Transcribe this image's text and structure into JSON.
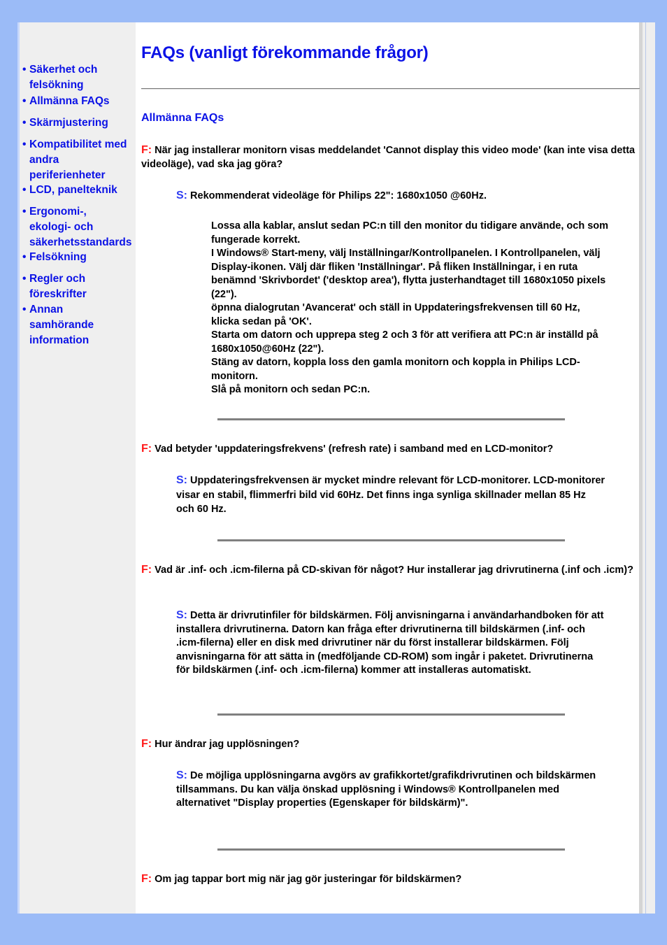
{
  "colors": {
    "page_background": "#9bbbf7",
    "sidebar_background": "#efefef",
    "link": "#0b12e6",
    "question_marker": "#ff1a1a",
    "answer_marker": "#2e3cf2"
  },
  "sidebar": {
    "bullet": "•",
    "items": [
      {
        "label": "Säkerhet och felsökning"
      },
      {
        "label": "Allmänna FAQs"
      },
      {
        "label": "Skärmjustering"
      },
      {
        "label": "Kompatibilitet med andra periferienheter"
      },
      {
        "label": "LCD, panelteknik"
      },
      {
        "label": "Ergonomi-, ekologi- och säkerhetsstandards"
      },
      {
        "label": "Felsökning"
      },
      {
        "label": "Regler och föreskrifter"
      },
      {
        "label": "Annan samhörande information"
      }
    ]
  },
  "page": {
    "title": "FAQs (vanligt förekommande frågor)",
    "section_heading": "Allmänna FAQs",
    "q_marker": "F:",
    "a_marker": "S:"
  },
  "faqs": [
    {
      "question": "När jag installerar monitorn visas meddelandet 'Cannot display this video mode' (kan inte visa detta videoläge), vad ska jag göra?",
      "answer": "Rekommenderat videoläge för Philips 22\": 1680x1050 @60Hz.",
      "steps": [
        "Lossa alla kablar, anslut sedan PC:n till den monitor du tidigare använde, och som fungerade korrekt.",
        "I Windows® Start-meny, välj Inställningar/Kontrollpanelen. I Kontrollpanelen, välj Display-ikonen. Välj där fliken 'Inställningar'. På fliken Inställningar, i en ruta benämnd 'Skrivbordet' ('desktop area'), flytta justerhandtaget till 1680x1050 pixels (22\").",
        "öpnna dialogrutan 'Avancerat' och ställ in Uppdateringsfrekvensen till 60 Hz, klicka sedan på 'OK'.",
        "Starta om datorn och upprepa steg 2 och 3 för att verifiera att PC:n är inställd på 1680x1050@60Hz (22\").",
        "Stäng av datorn, koppla loss den gamla monitorn och koppla in Philips LCD-monitorn.",
        "Slå på monitorn och sedan PC:n."
      ]
    },
    {
      "question": "Vad betyder 'uppdateringsfrekvens' (refresh rate) i samband med en LCD-monitor?",
      "answer": "Uppdateringsfrekvensen är mycket mindre relevant för LCD-monitorer. LCD-monitorer visar en stabil, flimmerfri bild vid 60Hz. Det finns inga synliga skillnader mellan 85 Hz och 60 Hz."
    },
    {
      "question": "Vad är .inf- och .icm-filerna på CD-skivan för något? Hur installerar jag drivrutinerna (.inf och .icm)?",
      "answer": "Detta är drivrutinfiler för bildskärmen. Följ anvisningarna i användarhandboken för att installera drivrutinerna. Datorn kan fråga efter drivrutinerna till bildskärmen (.inf- och .icm-filerna) eller en disk med drivrutiner när du först installerar bildskärmen. Följ anvisningarna för att sätta in (medföljande CD-ROM) som ingår i paketet. Drivrutinerna för bildskärmen (.inf- och .icm-filerna) kommer att installeras automatiskt."
    },
    {
      "question": "Hur ändrar jag upplösningen?",
      "answer": "De möjliga upplösningarna avgörs av grafikkortet/grafikdrivrutinen och bildskärmen tillsammans. Du kan välja önskad upplösning i Windows® Kontrollpanelen med alternativet \"Display properties (Egenskaper för bildskärm)\"."
    },
    {
      "question": "Om jag tappar bort mig när jag gör justeringar för bildskärmen?"
    }
  ]
}
